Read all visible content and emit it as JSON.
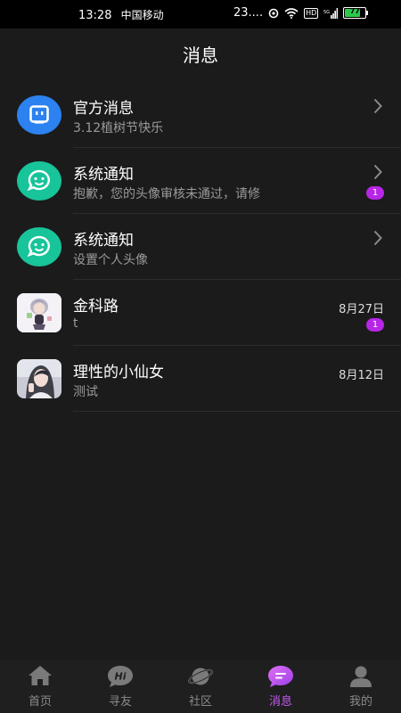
{
  "status_bar": {
    "time": "13:28",
    "carrier": "中国移动",
    "speed": "23....",
    "hd": "HD",
    "battery": "77"
  },
  "header": {
    "title": "消息"
  },
  "conversations": [
    {
      "name": "官方消息",
      "preview": "3.12植树节快乐",
      "icon": "tv-robot-icon",
      "chevron": true
    },
    {
      "name": "系统通知",
      "preview": "抱歉，您的头像审核未通过，请修",
      "icon": "smile-chat-icon",
      "chevron": true,
      "badge": "1"
    },
    {
      "name": "系统通知",
      "preview": "设置个人头像",
      "icon": "smile-chat-icon",
      "chevron": true
    },
    {
      "name": "金科路",
      "preview": "t",
      "date": "8月27日",
      "badge": "1",
      "icon": "anime-avatar"
    },
    {
      "name": "理性的小仙女",
      "preview": "测试",
      "date": "8月12日",
      "icon": "photo-avatar"
    }
  ],
  "tabs": [
    {
      "label": "首页",
      "icon": "home-icon"
    },
    {
      "label": "寻友",
      "icon": "hi-bubble-icon"
    },
    {
      "label": "社区",
      "icon": "planet-icon"
    },
    {
      "label": "消息",
      "icon": "message-icon",
      "active": true
    },
    {
      "label": "我的",
      "icon": "person-icon"
    }
  ],
  "colors": {
    "background": "#1b1b1b",
    "accent": "#c05bf0",
    "badge": "#b726e6",
    "official_blue": "#2b82f0",
    "notify_green": "#18c49a"
  }
}
